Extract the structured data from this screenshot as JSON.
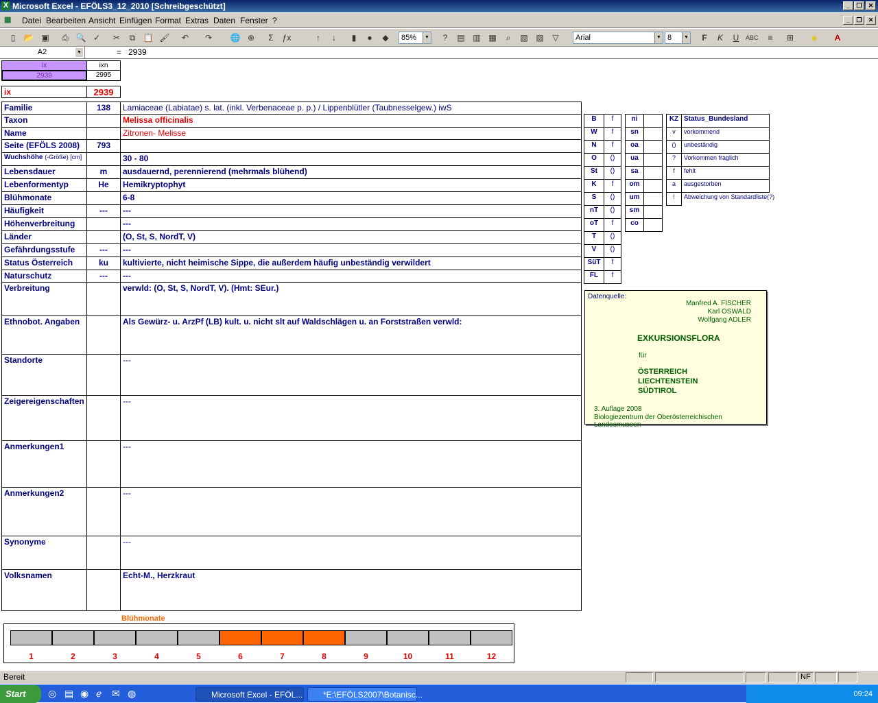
{
  "window": {
    "title": "Microsoft Excel - EFÖLS3_12_2010  [Schreibgeschützt]"
  },
  "menu": [
    "Datei",
    "Bearbeiten",
    "Ansicht",
    "Einfügen",
    "Format",
    "Extras",
    "Daten",
    "Fenster",
    "?"
  ],
  "toolbar": {
    "zoom": "85%",
    "font": "Arial",
    "size": "8"
  },
  "formula": {
    "namebox": "A2",
    "eq": "=",
    "value": "2939"
  },
  "top_index": {
    "h1": "ix",
    "h2": "ixn",
    "v1": "2939",
    "v2": "2995",
    "ix_label": "ix",
    "ix_value": "2939"
  },
  "rows": [
    {
      "label": "Familie",
      "code": "138",
      "value": "Lamiaceae (Labiatae) s. lat. (inkl. Verbenaceae p. p.)  /  Lippenblütler (Taubnesselgew.) iwS"
    },
    {
      "label": "Taxon",
      "code": "",
      "value": "Melissa officinalis"
    },
    {
      "label": "Name",
      "code": "",
      "value": "Zitronen- Melisse"
    },
    {
      "label": "Seite (EFÖLS 2008)",
      "code": "793",
      "value": ""
    },
    {
      "label": "Wuchshöhe",
      "label_small": "(-Größe) [cm]",
      "code": "",
      "value": " 30 - 80"
    },
    {
      "label": "Lebensdauer",
      "code": "m",
      "value": "ausdauernd, perennierend (mehrmals blühend)"
    },
    {
      "label": "Lebenformentyp",
      "code": "He",
      "value": "Hemikryptophyt"
    },
    {
      "label": "Blühmonate",
      "code": "",
      "value": " 6-8"
    },
    {
      "label": "Häufigkeit",
      "code": "---",
      "value": " ---"
    },
    {
      "label": "Höhenverbreitung",
      "code": "",
      "value": " ---"
    },
    {
      "label": "Länder",
      "code": "",
      "value": "(O, St, S, NordT, V)"
    },
    {
      "label": "Gefährdungsstufe",
      "code": "---",
      "value": "   ---"
    },
    {
      "label": "Status Österreich",
      "code": "ku",
      "value": "kultivierte, nicht heimische Sippe, die außerdem häufig unbeständig verwildert"
    },
    {
      "label": "Naturschutz",
      "code": "---",
      "value": " ---"
    },
    {
      "label": "Verbreitung",
      "code": "",
      "value": "verwld: (O, St, S, NordT, V). (Hmt: SEur.)"
    },
    {
      "label": "Ethnobot. Angaben",
      "code": "",
      "value": "Als Gewürz- u. ArzPf (LB) kult. u. nicht slt auf Waldschlägen u. an Forststraßen verwld:"
    },
    {
      "label": "Standorte",
      "code": "",
      "value": "---"
    },
    {
      "label": "Zeigereigenschaften",
      "code": "",
      "value": "---"
    },
    {
      "label": "Anmerkungen1",
      "code": "",
      "value": "---"
    },
    {
      "label": "Anmerkungen2",
      "code": "",
      "value": "---"
    },
    {
      "label": "Synonyme",
      "code": "",
      "value": "---"
    },
    {
      "label": "Volksnamen",
      "code": "",
      "value": "Echt-M., Herzkraut"
    }
  ],
  "laender": [
    {
      "k": "B",
      "v": "f"
    },
    {
      "k": "W",
      "v": "f"
    },
    {
      "k": "N",
      "v": "f"
    },
    {
      "k": "O",
      "v": "()"
    },
    {
      "k": "St",
      "v": "()"
    },
    {
      "k": "K",
      "v": "f"
    },
    {
      "k": "S",
      "v": "()"
    },
    {
      "k": "nT",
      "v": "()"
    },
    {
      "k": "oT",
      "v": "f"
    },
    {
      "k": "T",
      "v": "()"
    },
    {
      "k": "V",
      "v": "()"
    },
    {
      "k": "SüT",
      "v": "f"
    },
    {
      "k": "FL",
      "v": "f"
    }
  ],
  "hoehe": [
    "ni",
    "sn",
    "oa",
    "ua",
    "sa",
    "om",
    "um",
    "sm",
    "co"
  ],
  "status_legend": {
    "h1": "KZ",
    "h2": "Status_Bundesland",
    "items": [
      {
        "k": "v",
        "v": "vorkommend"
      },
      {
        "k": "()",
        "v": "unbeständig"
      },
      {
        "k": "?",
        "v": "Vorkommen fraglich"
      },
      {
        "k": "f",
        "v": "fehlt"
      },
      {
        "k": "a",
        "v": "ausgestorben"
      },
      {
        "k": "!",
        "v": "Abweichung von Standardliste(?)"
      }
    ]
  },
  "datenquelle": {
    "label": "Datenquelle:",
    "authors": [
      "Manfred A. FISCHER",
      "Karl OSWALD",
      "Wolfgang ADLER"
    ],
    "title": "EXKURSIONSFLORA",
    "fuer": "für",
    "regions": [
      "ÖSTERREICH",
      "LIECHTENSTEIN",
      "SÜDTIROL"
    ],
    "edition": "3. Auflage 2008",
    "publisher": "Biologiezentrum der Oberösterreichischen Landesmuseen"
  },
  "bluehmonate": {
    "title": "Blühmonate",
    "months": [
      "1",
      "2",
      "3",
      "4",
      "5",
      "6",
      "7",
      "8",
      "9",
      "10",
      "11",
      "12"
    ],
    "active": [
      6,
      7,
      8
    ],
    "active_color": "#ff6600"
  },
  "statusbar": {
    "text": "Bereit",
    "nf": "NF"
  },
  "taskbar": {
    "start": "Start",
    "task1": "Microsoft Excel - EFÖL...",
    "task2": "*E:\\EFÖLS2007\\Botanisc...",
    "time": "09:24"
  }
}
